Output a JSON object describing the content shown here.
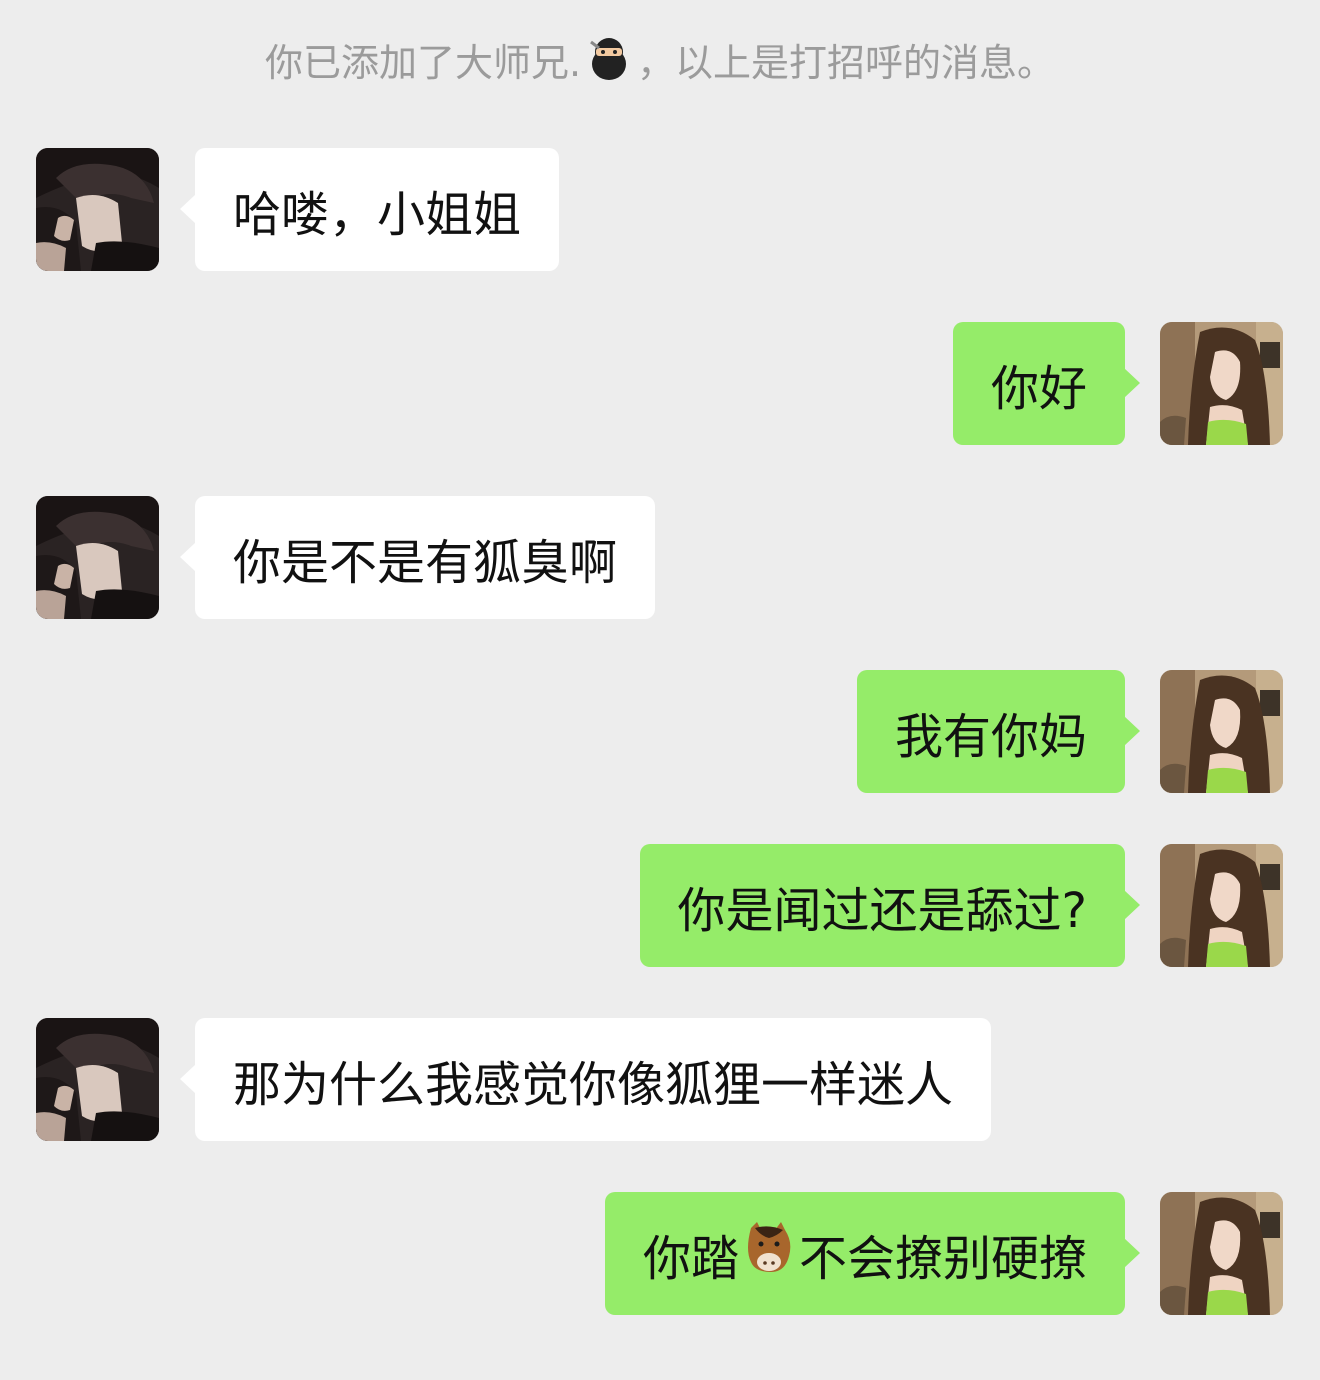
{
  "system_notice": {
    "before_emoji": "你已添加了大师兄.",
    "emoji": "ninja-icon",
    "after_emoji": "，以上是打招呼的消息。"
  },
  "colors": {
    "background": "#ededed",
    "incoming_bubble": "#ffffff",
    "outgoing_bubble": "#95ec69",
    "notice_text": "#9b9b9b"
  },
  "messages": [
    {
      "sender": "contact",
      "text": "哈喽，小姐姐"
    },
    {
      "sender": "me",
      "text": "你好"
    },
    {
      "sender": "contact",
      "text": "你是不是有狐臭啊"
    },
    {
      "sender": "me",
      "text": "我有你妈"
    },
    {
      "sender": "me",
      "text": "你是闻过还是舔过?"
    },
    {
      "sender": "contact",
      "text": "那为什么我感觉你像狐狸一样迷人"
    },
    {
      "sender": "me",
      "text_before": "你踏",
      "emoji": "horse-face-icon",
      "text_after": "不会撩别硬撩"
    }
  ]
}
